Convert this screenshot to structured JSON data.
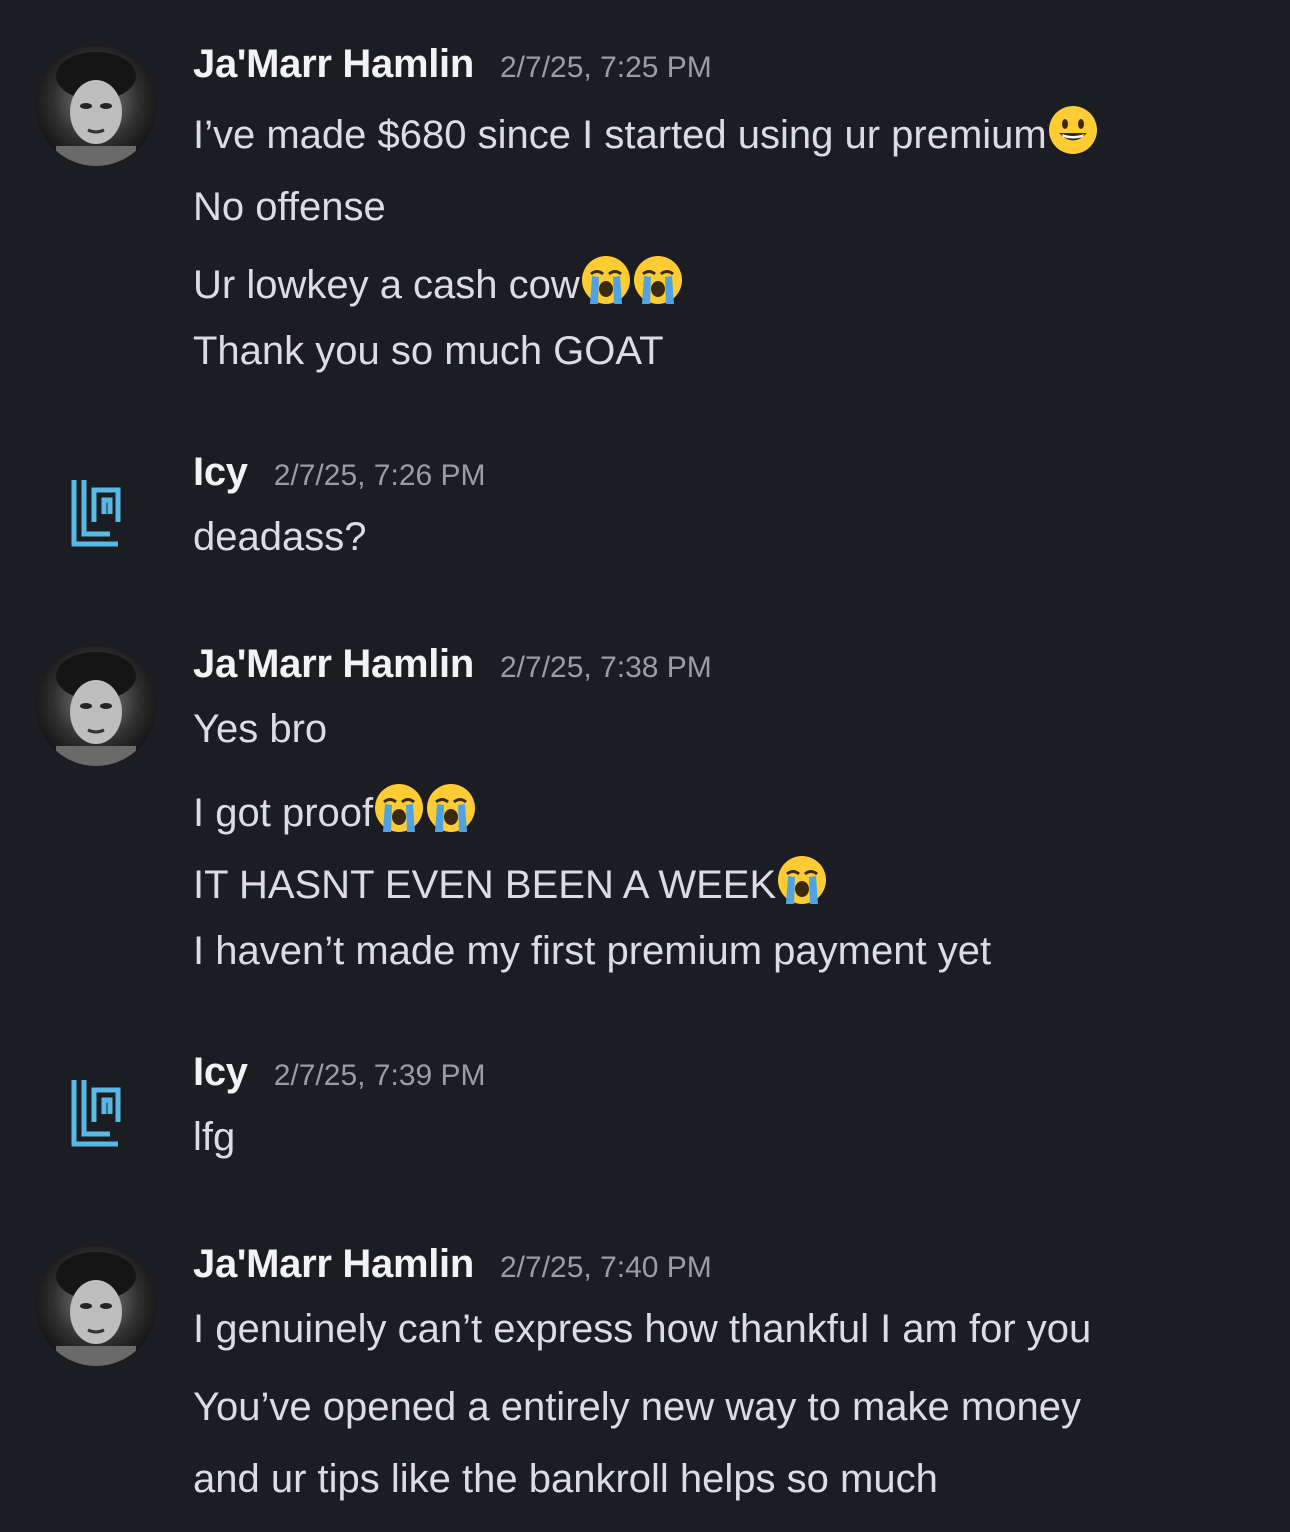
{
  "messages": [
    {
      "author": "Ja'Marr Hamlin",
      "time": "2/7/25, 7:25 PM",
      "avatar": "photo-avatar",
      "lines": [
        {
          "text": "I’ve made $680 since I started using ur premium",
          "emojis": [
            "smiley-emoji"
          ]
        },
        {
          "text": "No offense",
          "emojis": []
        },
        {
          "text": "Ur lowkey a cash cow",
          "emojis": [
            "loudly-crying-emoji",
            "loudly-crying-emoji"
          ]
        },
        {
          "text": "Thank you so much GOAT",
          "emojis": []
        }
      ]
    },
    {
      "author": "Icy",
      "time": "2/7/25, 7:26 PM",
      "avatar": "icy-logo",
      "lines": [
        {
          "text": "deadass?",
          "emojis": []
        }
      ]
    },
    {
      "author": "Ja'Marr Hamlin",
      "time": "2/7/25, 7:38 PM",
      "avatar": "photo-avatar",
      "lines": [
        {
          "text": "Yes bro",
          "emojis": []
        },
        {
          "text": "I got proof",
          "emojis": [
            "loudly-crying-emoji",
            "loudly-crying-emoji"
          ]
        },
        {
          "text": "IT HASNT EVEN BEEN A WEEK",
          "emojis": [
            "loudly-crying-emoji"
          ]
        },
        {
          "text": "I haven’t made my first premium payment yet",
          "emojis": []
        }
      ]
    },
    {
      "author": "Icy",
      "time": "2/7/25, 7:39 PM",
      "avatar": "icy-logo",
      "lines": [
        {
          "text": "lfg",
          "emojis": []
        }
      ]
    },
    {
      "author": "Ja'Marr Hamlin",
      "time": "2/7/25, 7:40 PM",
      "avatar": "photo-avatar",
      "lines": [
        {
          "text": "I genuinely can’t express how thankful I am for you",
          "emojis": []
        },
        {
          "text": "You’ve opened a entirely new way to make money",
          "emojis": []
        },
        {
          "text": "and ur tips like the bankroll helps so much",
          "emojis": []
        }
      ]
    }
  ],
  "colors": {
    "background": "#1c1d22",
    "username": "#f2f3f5",
    "timestamp": "#9a9ca6",
    "message": "#dcdde2",
    "icy_logo": "#5ab8e6"
  }
}
